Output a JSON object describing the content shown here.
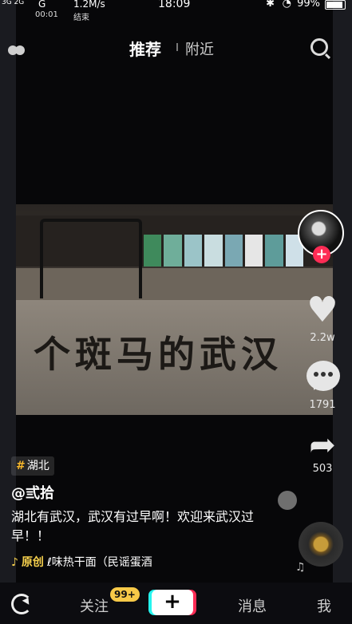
{
  "status_bar": {
    "signal_left": "3G\n2G",
    "network": "G",
    "speed": "1.2M/s",
    "clock": "18:09",
    "timer": "00:01",
    "finish_label": "结束",
    "battery": "99%"
  },
  "top_nav": {
    "tab_recommend": "推荐",
    "tab_nearby": "附近"
  },
  "video": {
    "sign_text": "个斑马的武汉",
    "book_colors": [
      "#3f8a5c",
      "#6fae9a",
      "#9bc4c8",
      "#c9dde0",
      "#7aa8b3",
      "#e6e6e6",
      "#5e9c9a",
      "#cfe0e8"
    ]
  },
  "side": {
    "like_count": "2.2w",
    "comment_count": "1791",
    "share_count": "503"
  },
  "post": {
    "hashtag": "湖北",
    "username": "@弎拾",
    "caption": "湖北有武汉，武汉有过早啊！欢迎来武汉过早！！",
    "music_original": "原创",
    "music_title": "ℓ味热干面（民谣蛋酒"
  },
  "bottom_nav": {
    "follow": "关注",
    "badge": "99+",
    "plus": "+",
    "messages": "消息",
    "me": "我"
  },
  "colors": {
    "accent_red": "#fe2c55",
    "accent_cyan": "#25f4ee",
    "badge_yellow": "#f7c948"
  }
}
